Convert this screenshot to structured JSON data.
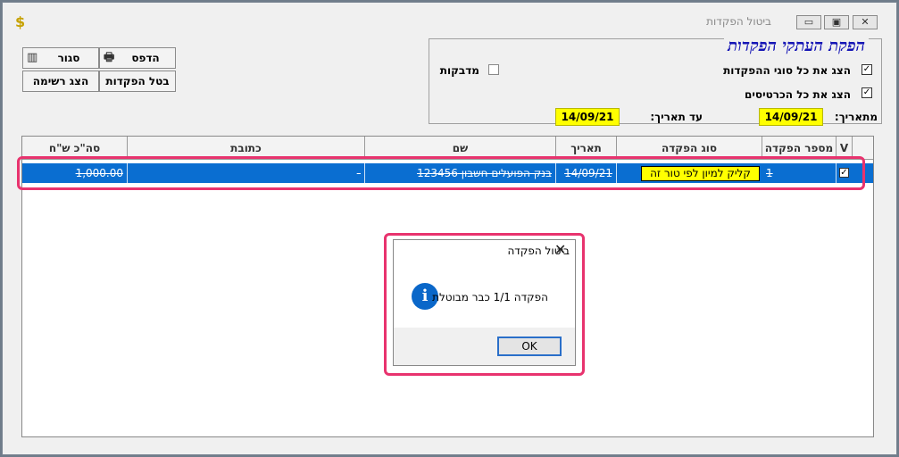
{
  "window": {
    "title": "ביטול הפקדות",
    "app_icon": "$",
    "controls": {
      "minimize": "▭",
      "restore": "▣",
      "close": "✕"
    }
  },
  "toolbar": {
    "print": "הדפס",
    "close": "סגור",
    "cancel_deposits": "בטל הפקדות",
    "show_list": "הצג רשימה"
  },
  "filters": {
    "group_title": "הפקת העתקי הפקדות",
    "show_all_types": "הצג את כל סוגי ההפקדות",
    "show_all_cards": "הצג את כל הכרטיסים",
    "stickers": "מדבקות",
    "from_label": "מתאריך:",
    "from_date": "14/09/21",
    "to_label": "עד תאריך:",
    "to_date": "14/09/21"
  },
  "grid": {
    "columns": [
      "V",
      "מספר הפקדה",
      "סוג הפקדה",
      "תאריך",
      "שם",
      "כתובת",
      "סה\"כ ש\"ח"
    ],
    "row": {
      "deposit_number": "1",
      "deposit_type_button": "קליק למיון לפי טור זה",
      "date": "14/09/21",
      "name": "בנק הפועלים חשבון 123456",
      "address": "-",
      "total": "1,000.00"
    }
  },
  "dialog": {
    "title": "ביטול הפקדה",
    "message": "הפקדה 1/1 כבר מבוטלת",
    "ok": "OK"
  },
  "colors": {
    "selection": "#0a6ed1",
    "highlight": "#e8336e",
    "yellow": "#ffff00",
    "group_title": "#1515b5"
  }
}
